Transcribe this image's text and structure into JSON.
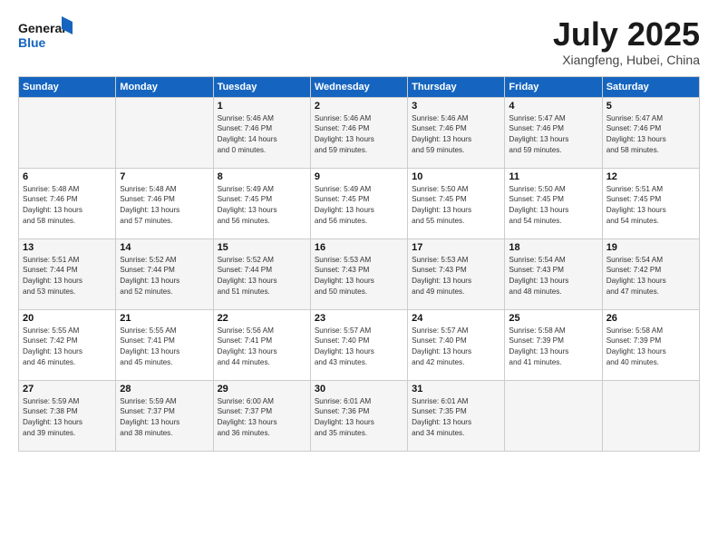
{
  "logo": {
    "line1": "General",
    "line2": "Blue"
  },
  "title": "July 2025",
  "location": "Xiangfeng, Hubei, China",
  "weekdays": [
    "Sunday",
    "Monday",
    "Tuesday",
    "Wednesday",
    "Thursday",
    "Friday",
    "Saturday"
  ],
  "weeks": [
    [
      {
        "day": "",
        "text": ""
      },
      {
        "day": "",
        "text": ""
      },
      {
        "day": "1",
        "text": "Sunrise: 5:46 AM\nSunset: 7:46 PM\nDaylight: 14 hours\nand 0 minutes."
      },
      {
        "day": "2",
        "text": "Sunrise: 5:46 AM\nSunset: 7:46 PM\nDaylight: 13 hours\nand 59 minutes."
      },
      {
        "day": "3",
        "text": "Sunrise: 5:46 AM\nSunset: 7:46 PM\nDaylight: 13 hours\nand 59 minutes."
      },
      {
        "day": "4",
        "text": "Sunrise: 5:47 AM\nSunset: 7:46 PM\nDaylight: 13 hours\nand 59 minutes."
      },
      {
        "day": "5",
        "text": "Sunrise: 5:47 AM\nSunset: 7:46 PM\nDaylight: 13 hours\nand 58 minutes."
      }
    ],
    [
      {
        "day": "6",
        "text": "Sunrise: 5:48 AM\nSunset: 7:46 PM\nDaylight: 13 hours\nand 58 minutes."
      },
      {
        "day": "7",
        "text": "Sunrise: 5:48 AM\nSunset: 7:46 PM\nDaylight: 13 hours\nand 57 minutes."
      },
      {
        "day": "8",
        "text": "Sunrise: 5:49 AM\nSunset: 7:45 PM\nDaylight: 13 hours\nand 56 minutes."
      },
      {
        "day": "9",
        "text": "Sunrise: 5:49 AM\nSunset: 7:45 PM\nDaylight: 13 hours\nand 56 minutes."
      },
      {
        "day": "10",
        "text": "Sunrise: 5:50 AM\nSunset: 7:45 PM\nDaylight: 13 hours\nand 55 minutes."
      },
      {
        "day": "11",
        "text": "Sunrise: 5:50 AM\nSunset: 7:45 PM\nDaylight: 13 hours\nand 54 minutes."
      },
      {
        "day": "12",
        "text": "Sunrise: 5:51 AM\nSunset: 7:45 PM\nDaylight: 13 hours\nand 54 minutes."
      }
    ],
    [
      {
        "day": "13",
        "text": "Sunrise: 5:51 AM\nSunset: 7:44 PM\nDaylight: 13 hours\nand 53 minutes."
      },
      {
        "day": "14",
        "text": "Sunrise: 5:52 AM\nSunset: 7:44 PM\nDaylight: 13 hours\nand 52 minutes."
      },
      {
        "day": "15",
        "text": "Sunrise: 5:52 AM\nSunset: 7:44 PM\nDaylight: 13 hours\nand 51 minutes."
      },
      {
        "day": "16",
        "text": "Sunrise: 5:53 AM\nSunset: 7:43 PM\nDaylight: 13 hours\nand 50 minutes."
      },
      {
        "day": "17",
        "text": "Sunrise: 5:53 AM\nSunset: 7:43 PM\nDaylight: 13 hours\nand 49 minutes."
      },
      {
        "day": "18",
        "text": "Sunrise: 5:54 AM\nSunset: 7:43 PM\nDaylight: 13 hours\nand 48 minutes."
      },
      {
        "day": "19",
        "text": "Sunrise: 5:54 AM\nSunset: 7:42 PM\nDaylight: 13 hours\nand 47 minutes."
      }
    ],
    [
      {
        "day": "20",
        "text": "Sunrise: 5:55 AM\nSunset: 7:42 PM\nDaylight: 13 hours\nand 46 minutes."
      },
      {
        "day": "21",
        "text": "Sunrise: 5:55 AM\nSunset: 7:41 PM\nDaylight: 13 hours\nand 45 minutes."
      },
      {
        "day": "22",
        "text": "Sunrise: 5:56 AM\nSunset: 7:41 PM\nDaylight: 13 hours\nand 44 minutes."
      },
      {
        "day": "23",
        "text": "Sunrise: 5:57 AM\nSunset: 7:40 PM\nDaylight: 13 hours\nand 43 minutes."
      },
      {
        "day": "24",
        "text": "Sunrise: 5:57 AM\nSunset: 7:40 PM\nDaylight: 13 hours\nand 42 minutes."
      },
      {
        "day": "25",
        "text": "Sunrise: 5:58 AM\nSunset: 7:39 PM\nDaylight: 13 hours\nand 41 minutes."
      },
      {
        "day": "26",
        "text": "Sunrise: 5:58 AM\nSunset: 7:39 PM\nDaylight: 13 hours\nand 40 minutes."
      }
    ],
    [
      {
        "day": "27",
        "text": "Sunrise: 5:59 AM\nSunset: 7:38 PM\nDaylight: 13 hours\nand 39 minutes."
      },
      {
        "day": "28",
        "text": "Sunrise: 5:59 AM\nSunset: 7:37 PM\nDaylight: 13 hours\nand 38 minutes."
      },
      {
        "day": "29",
        "text": "Sunrise: 6:00 AM\nSunset: 7:37 PM\nDaylight: 13 hours\nand 36 minutes."
      },
      {
        "day": "30",
        "text": "Sunrise: 6:01 AM\nSunset: 7:36 PM\nDaylight: 13 hours\nand 35 minutes."
      },
      {
        "day": "31",
        "text": "Sunrise: 6:01 AM\nSunset: 7:35 PM\nDaylight: 13 hours\nand 34 minutes."
      },
      {
        "day": "",
        "text": ""
      },
      {
        "day": "",
        "text": ""
      }
    ]
  ]
}
